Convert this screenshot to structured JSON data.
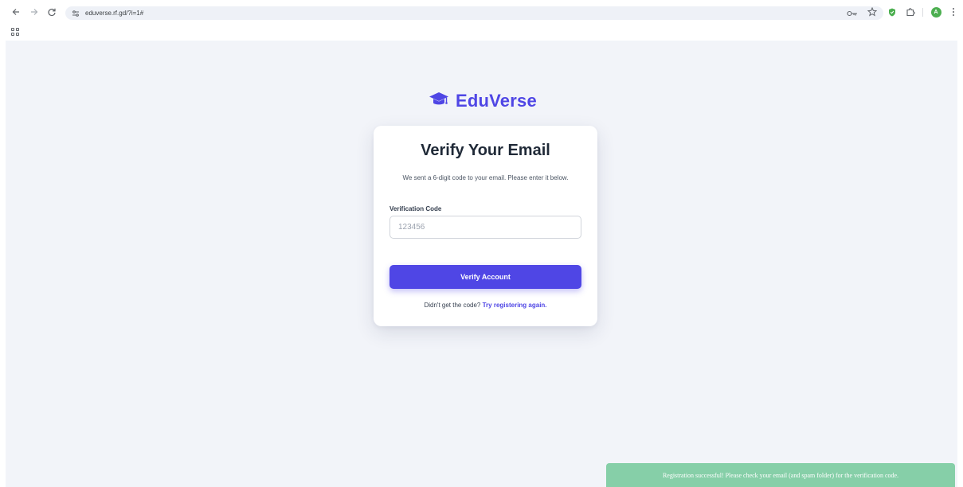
{
  "browser": {
    "url": "eduverse.rf.gd/?i=1#",
    "profile_initial": "A"
  },
  "brand": {
    "name": "EduVerse",
    "color": "#4f46e5"
  },
  "card": {
    "title": "Verify Your Email",
    "subtitle": "We sent a 6-digit code to your email. Please enter it below.",
    "code_label": "Verification Code",
    "code_placeholder": "123456",
    "code_value": "",
    "submit_label": "Verify Account",
    "resend_prompt": "Didn't get the code?",
    "resend_link": "Try registering again."
  },
  "toast": {
    "message": "Registration successful! Please check your email (and spam folder) for the verification code.",
    "color": "#86cfa8"
  },
  "icons": {
    "back": "back-arrow-icon",
    "forward": "forward-arrow-icon",
    "reload": "reload-icon",
    "site_settings": "tune-icon",
    "password": "key-icon",
    "bookmark": "star-icon",
    "extension_shield": "shield-icon",
    "extensions": "puzzle-icon",
    "menu": "kebab-menu-icon",
    "apps": "apps-grid-icon",
    "brand": "graduation-cap-icon"
  }
}
